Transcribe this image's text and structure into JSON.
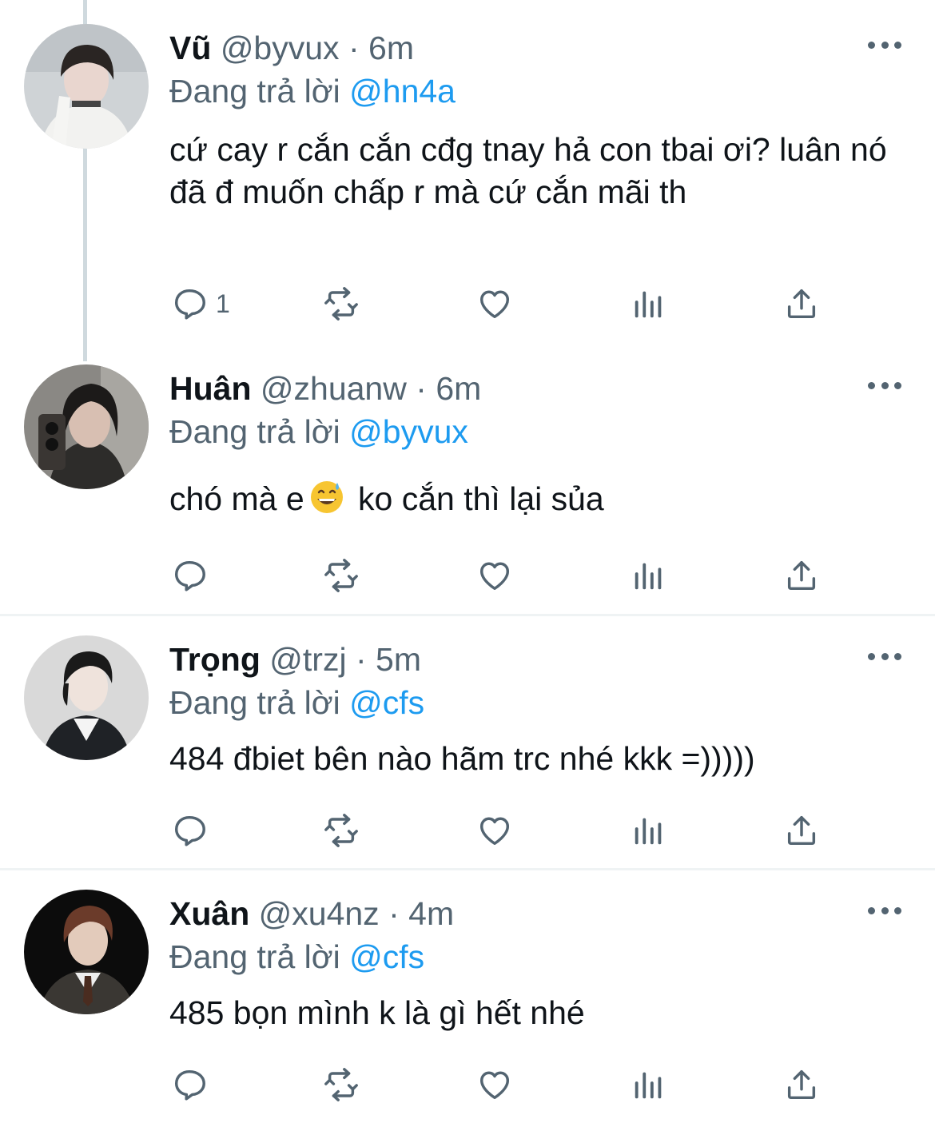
{
  "tweets": [
    {
      "name": "Vũ",
      "handle": "@byvux",
      "separator": "·",
      "time": "6m",
      "reply_prefix": "Đang trả lời",
      "reply_to": "@hn4a",
      "text": "cứ cay r cắn cắn cđg tnay hả con tbai ơi? luân nó đã đ muốn chấp r mà cứ cắn mãi th",
      "reply_count": "1",
      "avatar_colors": {
        "bg": "#cfd3d6",
        "hair": "#2a2523",
        "skin": "#e9d6cf",
        "cloth": "#f2f2f0"
      }
    },
    {
      "name": "Huân",
      "handle": "@zhuanw",
      "separator": "·",
      "time": "6m",
      "reply_prefix": "Đang trả lời",
      "reply_to": "@byvux",
      "text_before": "chó mà e",
      "emoji_icon": "grinning-sweat-emoji-icon",
      "text_after": " ko cắn thì lại sủa",
      "reply_count": "",
      "avatar_colors": {
        "bg": "#8a8884",
        "hair": "#1c1a19",
        "skin": "#d8bfb2",
        "cloth": "#2d2c2a"
      }
    },
    {
      "name": "Trọng",
      "handle": "@trzj",
      "separator": "·",
      "time": "5m",
      "reply_prefix": "Đang trả lời",
      "reply_to": "@cfs",
      "text": "484 đbiet bên nào hãm trc nhé kkk =)))))",
      "reply_count": "",
      "avatar_colors": {
        "bg": "#d9d9d9",
        "hair": "#1a1a1a",
        "skin": "#efe3dc",
        "cloth": "#1f2226"
      }
    },
    {
      "name": "Xuân",
      "handle": "@xu4nz",
      "separator": "·",
      "time": "4m",
      "reply_prefix": "Đang trả lời",
      "reply_to": "@cfs",
      "text": "485 bọn mình k là gì hết nhé",
      "reply_count": "",
      "avatar_colors": {
        "bg": "#0c0c0c",
        "hair": "#6b3b2a",
        "skin": "#e3cbbb",
        "cloth": "#3a3733"
      }
    }
  ],
  "actions": {
    "reply_icon": "reply-icon",
    "retweet_icon": "retweet-icon",
    "like_icon": "heart-icon",
    "views_icon": "views-chart-icon",
    "share_icon": "share-icon",
    "more_icon": "more-dots-icon"
  },
  "colors": {
    "text_primary": "#0f1419",
    "text_secondary": "#536471",
    "link": "#1d9bf0",
    "divider": "#eff3f4",
    "thread_line": "#cfd9de"
  }
}
